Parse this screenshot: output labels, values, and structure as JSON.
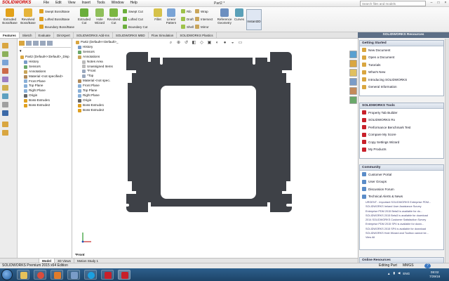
{
  "app": {
    "logo": "SOLIDWORKS",
    "document_title": "Part2 *",
    "menus": [
      "File",
      "Edit",
      "View",
      "Insert",
      "Tools",
      "Window",
      "Help"
    ],
    "search_placeholder": "Search files and models"
  },
  "ribbon": {
    "extruded_boss": "Extruded Boss/Base",
    "revolved_boss": "Revolved Boss/Base",
    "swept_boss": "Swept Boss/Base",
    "lofted_boss": "Lofted Boss/Base",
    "boundary_boss": "Boundary Boss/Base",
    "extruded_cut": "Extruded Cut",
    "hole_wizard": "Hole Wizard",
    "revolved_cut": "Revolved Cut",
    "swept_cut": "Swept Cut",
    "lofted_cut": "Lofted Cut",
    "boundary_cut": "Boundary Cut",
    "fillet": "Fillet",
    "linear_pattern": "Linear Pattern",
    "rib": "Rib",
    "draft": "Draft",
    "shell": "Shell",
    "wrap": "Wrap",
    "intersect": "Intersect",
    "mirror": "Mirror",
    "reference_geometry": "Reference Geometry",
    "curves": "Curves",
    "instant3d": "Instant3D"
  },
  "command_tabs": [
    "Features",
    "Sketch",
    "Evaluate",
    "DimXpert",
    "SOLIDWORKS Add-Ins",
    "SOLIDWORKS MBD",
    "Flow Simulation",
    "SOLIDWORKS Plastics"
  ],
  "feature_tree": [
    {
      "label": "Part2 (Default<<Default>_Disp",
      "icon": "part-icon"
    },
    {
      "label": "History",
      "icon": "history-icon"
    },
    {
      "label": "Sensors",
      "icon": "sensor-icon"
    },
    {
      "label": "Annotations",
      "icon": "annotation-icon"
    },
    {
      "label": "Material <not specified>",
      "icon": "material-icon"
    },
    {
      "label": "Front Plane",
      "icon": "plane-icon"
    },
    {
      "label": "Top Plane",
      "icon": "plane-icon"
    },
    {
      "label": "Right Plane",
      "icon": "plane-icon"
    },
    {
      "label": "Origin",
      "icon": "origin-icon"
    },
    {
      "label": "Boss-Extrude1",
      "icon": "extrude-icon"
    },
    {
      "label": "Boss-Extrude2",
      "icon": "extrude-icon"
    }
  ],
  "flyout_tree": [
    {
      "label": "Part2 (Default<<Default>_",
      "icon": "part-icon"
    },
    {
      "label": "History",
      "icon": "history-icon"
    },
    {
      "label": "Sensors",
      "icon": "sensor-icon"
    },
    {
      "label": "Annotations",
      "icon": "annotation-icon"
    },
    {
      "label": "Notes Area",
      "icon": "note-icon"
    },
    {
      "label": "Unassigned Items",
      "icon": "note-icon"
    },
    {
      "label": "*Front",
      "icon": "view-icon"
    },
    {
      "label": "*Top",
      "icon": "view-icon"
    },
    {
      "label": "Material <not specified>",
      "icon": "material-icon"
    },
    {
      "label": "Front Plane",
      "icon": "plane-icon"
    },
    {
      "label": "Top Plane",
      "icon": "plane-icon"
    },
    {
      "label": "Right Plane",
      "icon": "plane-icon"
    },
    {
      "label": "Origin",
      "icon": "origin-icon"
    },
    {
      "label": "Boss-Extrude1",
      "icon": "extrude-icon"
    },
    {
      "label": "Boss-Extrude2",
      "icon": "extrude-icon"
    }
  ],
  "viewport": {
    "view_label": "*Front",
    "part_color": "#3e4147"
  },
  "bottom_tabs": [
    "Model",
    "3D Views",
    "Motion Study 1"
  ],
  "status": {
    "left": "SOLIDWORKS Premium 2015 x64 Edition",
    "mode": "Editing Part",
    "units": "MMGS"
  },
  "resources": {
    "header": "SOLIDWORKS Resources",
    "getting_started": {
      "title": "Getting Started",
      "items": [
        "New Document",
        "Open a Document",
        "Tutorials",
        "What's New",
        "Introducing SOLIDWORKS",
        "General Information"
      ]
    },
    "tools": {
      "title": "SOLIDWORKS Tools",
      "items": [
        "Property Tab Builder",
        "SOLIDWORKS Rx",
        "Performance Benchmark Test",
        "Compare My Score",
        "Copy Settings Wizard",
        "My Products"
      ]
    },
    "community": {
      "title": "Community",
      "items": [
        "Customer Portal",
        "User Groups",
        "Discussion Forum",
        "Technical Alerts & News"
      ],
      "news": [
        "URGENT - Important SOLIDWORKS Enterprise PDM...",
        "SOLIDWORKS Ireland User Assistance Survey",
        "Enterprise PDM 2015 Beta3 is available for do...",
        "SOLIDWORKS 2015 Beta3 is available for download",
        "2014 SOLIDWORKS Customer Satisfaction Survey",
        "Enterprise PDM 2015 SP4 is available for down...",
        "SOLIDWORKS 2015 SP4 is available for download",
        "SOLIDWORKS Hole Wizard and Toolbox cannot be...",
        "View All"
      ]
    },
    "online": {
      "title": "Online Resources"
    }
  },
  "taskbar": {
    "tray_lang": "ENG",
    "time": "08:02",
    "date": "7/29/16"
  },
  "colors": {
    "accent": "#5d6f86",
    "ribbon_bg": "#ececec",
    "taskbar": "#1d4468"
  }
}
